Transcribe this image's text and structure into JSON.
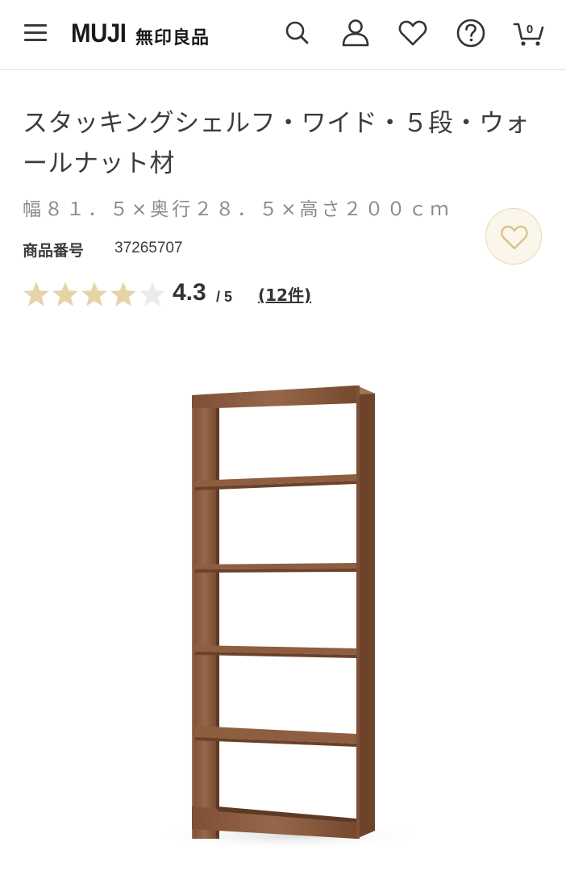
{
  "header": {
    "logo_en": "MUJI",
    "logo_jp": "無印良品",
    "cart_count": "0",
    "icons": [
      "menu-icon",
      "search-icon",
      "user-icon",
      "heart-icon",
      "help-icon",
      "cart-icon"
    ]
  },
  "product": {
    "title_line1": "スタッキングシェルフ・ワイド・５段・ウォ",
    "title_line2": "ールナット材",
    "size": "幅８１．５×奥行２８．５×高さ２００ｃｍ",
    "product_number_label": "商品番号",
    "product_number": "37265707",
    "rating": {
      "score": "4.3",
      "out_of": "/ 5",
      "reviews": "(12件)",
      "stars_filled": 4.3,
      "stars_max": 5
    }
  },
  "colors": {
    "star": "#e6d3a8",
    "star_empty": "#e8e8e8",
    "fav_bg": "#fbf6ea",
    "wood": "#8a5a3c"
  }
}
